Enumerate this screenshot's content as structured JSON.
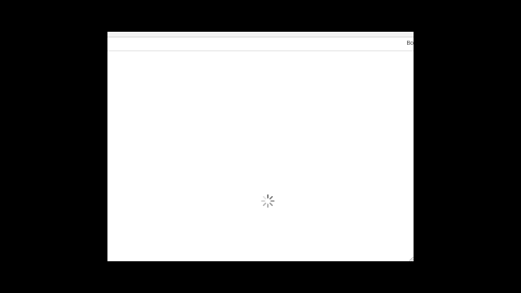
{
  "window": {
    "title": "",
    "toolbar_label": "Bo"
  },
  "content": {
    "state": "loading",
    "spinner_icon": "loading-spinner-icon"
  },
  "colors": {
    "desktop_background": "#000000",
    "page_background": "#ffffff",
    "spinner": "#666666"
  }
}
